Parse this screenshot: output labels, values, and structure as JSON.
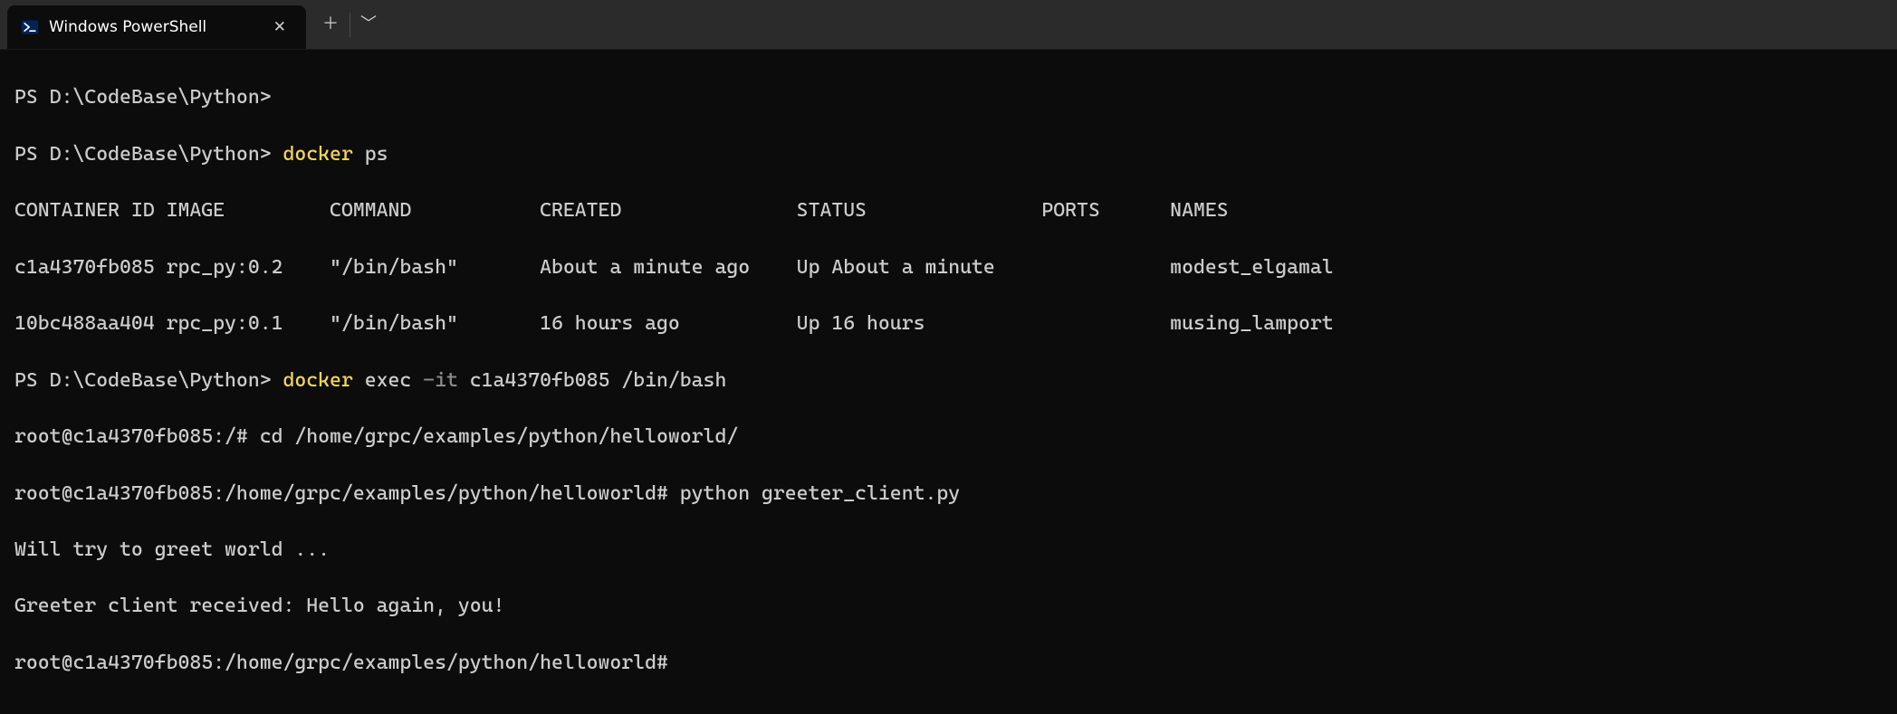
{
  "tabstrip": {
    "tab_title": "Windows PowerShell",
    "close_glyph": "✕",
    "new_tab_glyph": "＋",
    "dropdown_glyph": "﹀"
  },
  "prompt": "PS D:\\CodeBase\\Python>",
  "cmd1": {
    "word1": "docker",
    "rest": "ps"
  },
  "ps_table": {
    "headers": {
      "id": "CONTAINER ID",
      "image": "IMAGE",
      "command": "COMMAND",
      "created": "CREATED",
      "status": "STATUS",
      "ports": "PORTS",
      "names": "NAMES"
    },
    "rows": [
      {
        "id": "c1a4370fb085",
        "image": "rpc_py:0.2",
        "command": "\"/bin/bash\"",
        "created": "About a minute ago",
        "status": "Up About a minute",
        "ports": "",
        "names": "modest_elgamal"
      },
      {
        "id": "10bc488aa404",
        "image": "rpc_py:0.1",
        "command": "\"/bin/bash\"",
        "created": "16 hours ago",
        "status": "Up 16 hours",
        "ports": "",
        "names": "musing_lamport"
      }
    ]
  },
  "cmd2": {
    "word1": "docker",
    "rest_a": "exec",
    "flag": "-it",
    "rest_b": "c1a4370fb085 /bin/bash"
  },
  "bash": {
    "prompt_root": "root@c1a4370fb085:/#",
    "cd_cmd": "cd /home/grpc/examples/python/helloworld/",
    "prompt_hw": "root@c1a4370fb085:/home/grpc/examples/python/helloworld#",
    "py_cmd": "python greeter_client.py",
    "out1": "Will try to greet world ...",
    "out2": "Greeter client received: Hello again, you!"
  }
}
